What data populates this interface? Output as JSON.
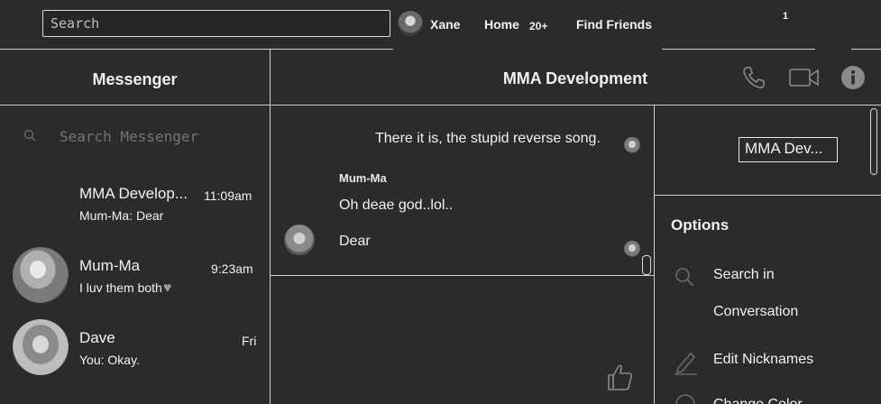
{
  "topbar": {
    "search_placeholder": "Search",
    "user_name": "Xane",
    "home_label": "Home",
    "home_count": "20+",
    "find_friends_label": "Find Friends",
    "notification_count": "1"
  },
  "sidebar": {
    "title": "Messenger",
    "search_placeholder": "Search Messenger",
    "conversations": [
      {
        "name": "MMA Develop...",
        "time": "11:09am",
        "snippet": "Mum-Ma: Dear"
      },
      {
        "name": "Mum-Ma",
        "time": "9:23am",
        "snippet": "I luv them both"
      },
      {
        "name": "Dave",
        "time": "Fri",
        "snippet": "You: Okay."
      }
    ]
  },
  "chat": {
    "title": "MMA Development",
    "messages": [
      {
        "text": "There it is, the stupid reverse song."
      },
      {
        "sender": "Mum-Ma",
        "text": "Oh deae god..lol.."
      },
      {
        "text": "Dear"
      }
    ],
    "icons": [
      "phone-icon",
      "video-icon",
      "info-icon",
      "like-icon"
    ]
  },
  "details": {
    "conversation_name": "MMA Dev...",
    "options_title": "Options",
    "options": [
      {
        "label_line1": "Search in",
        "label_line2": "Conversation",
        "icon": "search-icon"
      },
      {
        "label_line1": "Edit Nicknames",
        "icon": "pencil-icon"
      },
      {
        "label_line1": "Change Color",
        "icon": "color-icon"
      }
    ]
  },
  "colors": {
    "background": "#2b2b2b",
    "divider": "#cfcfcf",
    "text": "#f2f2f2"
  }
}
